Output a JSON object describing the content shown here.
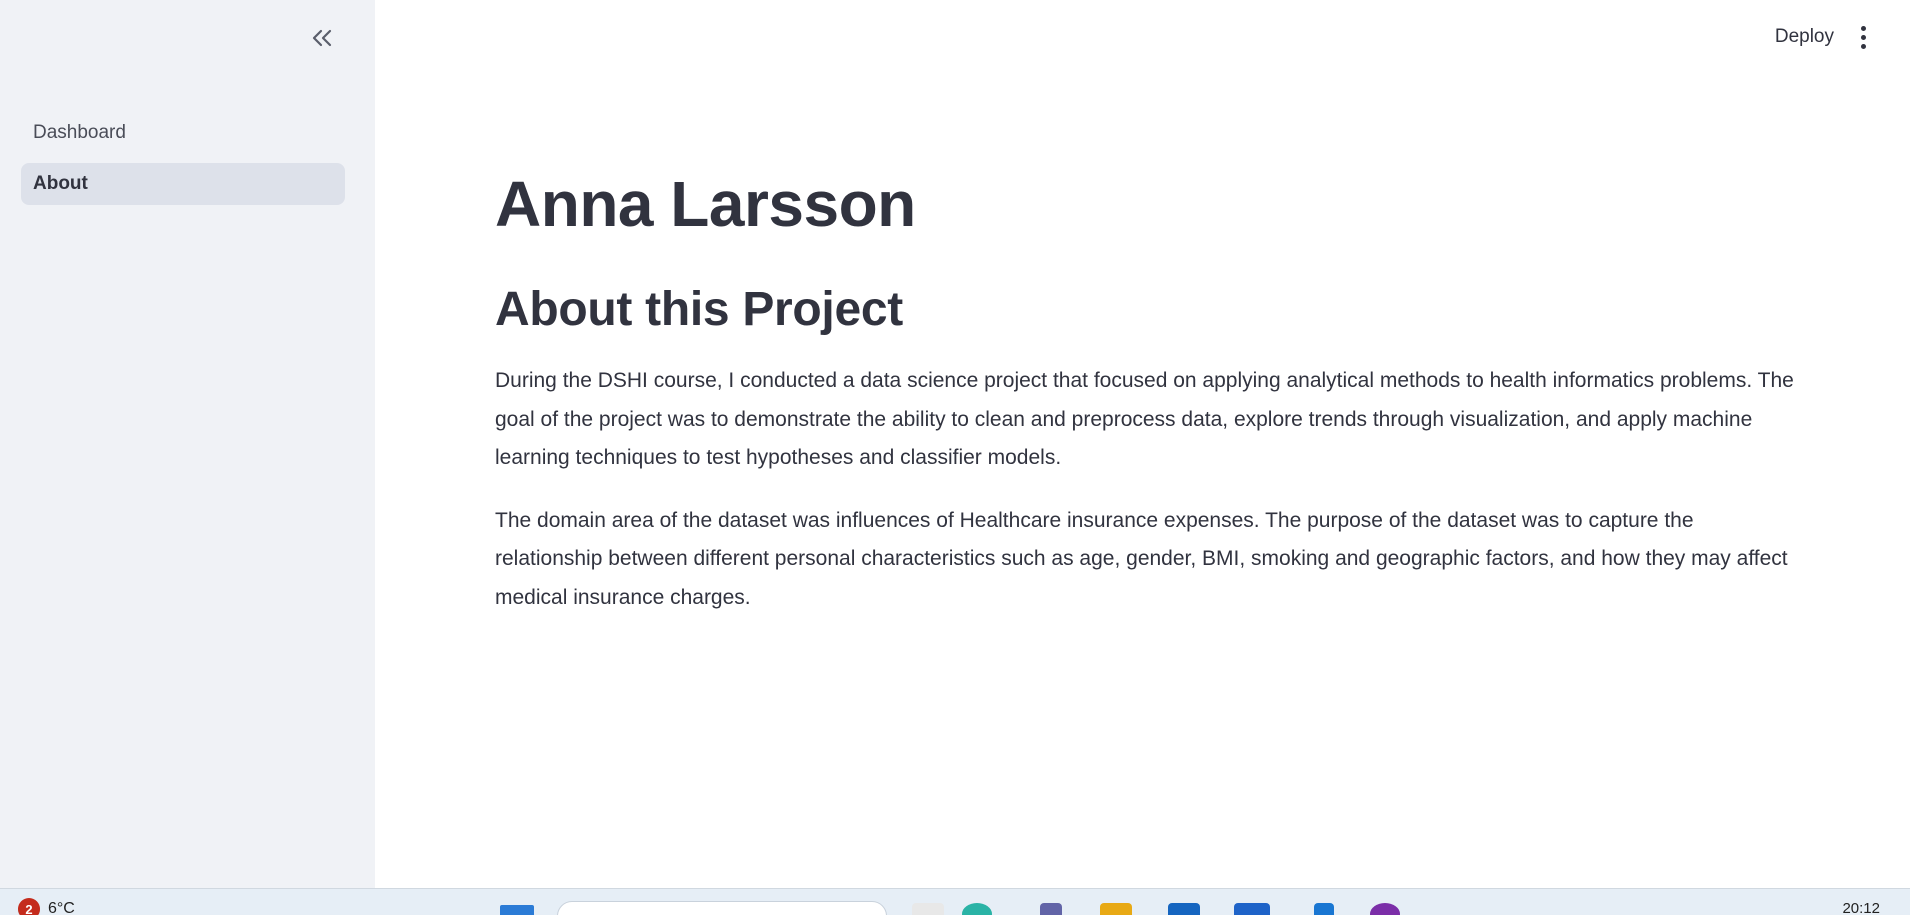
{
  "sidebar": {
    "items": [
      {
        "label": "Dashboard",
        "active": false
      },
      {
        "label": "About",
        "active": true
      }
    ]
  },
  "header": {
    "deploy_label": "Deploy"
  },
  "main": {
    "title": "Anna Larsson",
    "section_heading": "About this Project",
    "paragraphs": [
      "During the DSHI course, I conducted a data science project that focused on applying analytical methods to health informatics problems. The goal of the project was to demonstrate the ability to clean and preprocess data, explore trends through visualization, and apply machine learning techniques to test hypotheses and classifier models.",
      "The domain area of the dataset was influences of Healthcare insurance expenses. The purpose of the dataset was to capture the relationship between different personal characteristics such as age, gender, BMI, smoking and geographic factors, and how they may affect medical insurance charges."
    ]
  },
  "taskbar": {
    "notification_count": "2",
    "temperature": "6°C",
    "clock": "20:12"
  },
  "colors": {
    "sidebar_bg": "#f0f2f6",
    "active_item_bg": "#dde1ea",
    "text": "#31333f"
  }
}
